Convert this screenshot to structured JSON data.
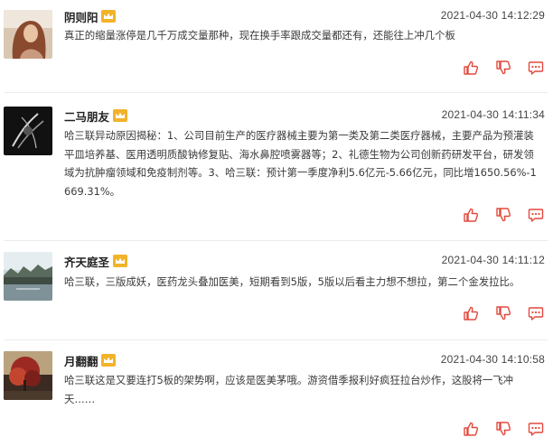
{
  "colors": {
    "accent": "#e2493d",
    "crown": "#f2b32a",
    "separator": "#ebebeb"
  },
  "icons": {
    "like": "thumbs-up-icon",
    "dislike": "thumbs-down-icon",
    "reply": "comment-icon",
    "vip": "crown-icon"
  },
  "posts": [
    {
      "user": "阴则阳",
      "time": "2021-04-30 14:12:29",
      "content": "真正的缩量涨停是几千万成交量那种，现在换手率跟成交量都还有，还能往上冲几个板"
    },
    {
      "user": "二马朋友",
      "time": "2021-04-30 14:11:34",
      "content": "哈三联异动原因揭秘：1、公司目前生产的医疗器械主要为第一类及第二类医疗器械，主要产品为预灌装平皿培养基、医用透明质酸钠修复贴、海水鼻腔喷雾器等；2、礼德生物为公司创新药研发平台，研发领域为抗肿瘤领域和免疫制剂等。3、哈三联：预计第一季度净利5.6亿元-5.66亿元，同比增1650.56%-1669.31%。"
    },
    {
      "user": "齐天庭圣",
      "time": "2021-04-30 14:11:12",
      "content": "哈三联，三版成妖，医药龙头叠加医美，短期看到5版，5版以后看主力想不想拉，第二个金发拉比。"
    },
    {
      "user": "月翻翻",
      "time": "2021-04-30 14:10:58",
      "content": "哈三联这是又要连打5板的架势啊，应该是医美茅哦。游资借季报利好疯狂拉台炒作，这股将一飞冲天……"
    }
  ]
}
